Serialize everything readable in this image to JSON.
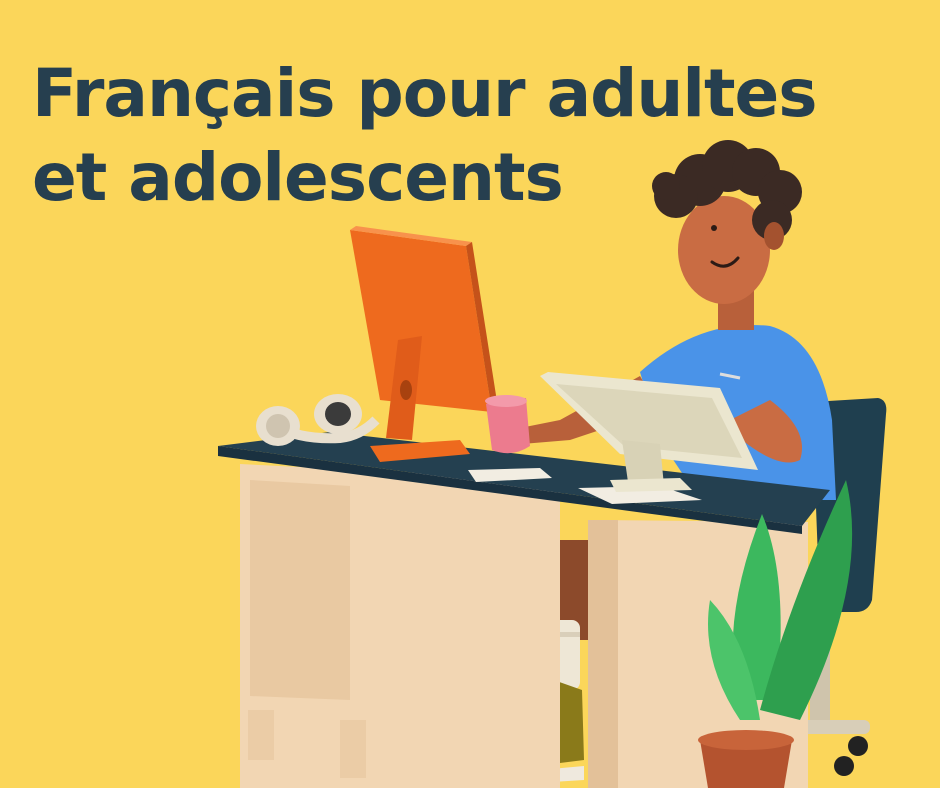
{
  "headline": {
    "line1": "Français pour adultes",
    "line2": "et adolescents"
  },
  "colors": {
    "background": "#fbd65a",
    "headline_text": "#263f4f",
    "desk_top": "#244050",
    "desk_body": "#f2d6b3",
    "monitor": "#ee6a1e",
    "shirt": "#4a93e8",
    "plant": "#34b55b",
    "pot": "#b4532f"
  },
  "icons": [
    "person-illustration",
    "desk-icon",
    "monitor-icon",
    "laptop-icon",
    "headphones-icon",
    "mug-icon",
    "plant-icon",
    "chair-icon",
    "sneaker-icon"
  ]
}
